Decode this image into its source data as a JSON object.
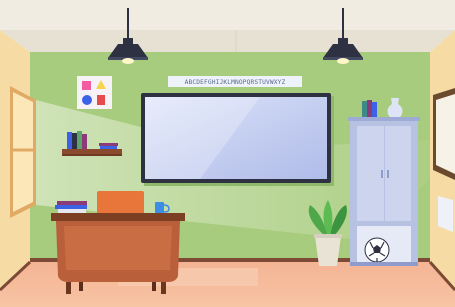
{
  "scene": {
    "alphabet_strip": "ABCDEFGHIJKLMNOPQRSTUVWXYZ",
    "colors": {
      "wall": "#a8cc7d",
      "ceiling": "#f0ece2",
      "floor": "#f4b793",
      "side_wall": "#f6dca4",
      "whiteboard_frame": "#2d3142",
      "desk": "#b9603a",
      "cabinet": "#c9d2ea",
      "lamp": "#2d3142"
    },
    "icons": [
      "pendant-lamp-icon",
      "shapes-poster-icon",
      "soccer-ball-icon",
      "plant-icon",
      "laptop-icon",
      "mug-icon",
      "vase-icon"
    ]
  }
}
